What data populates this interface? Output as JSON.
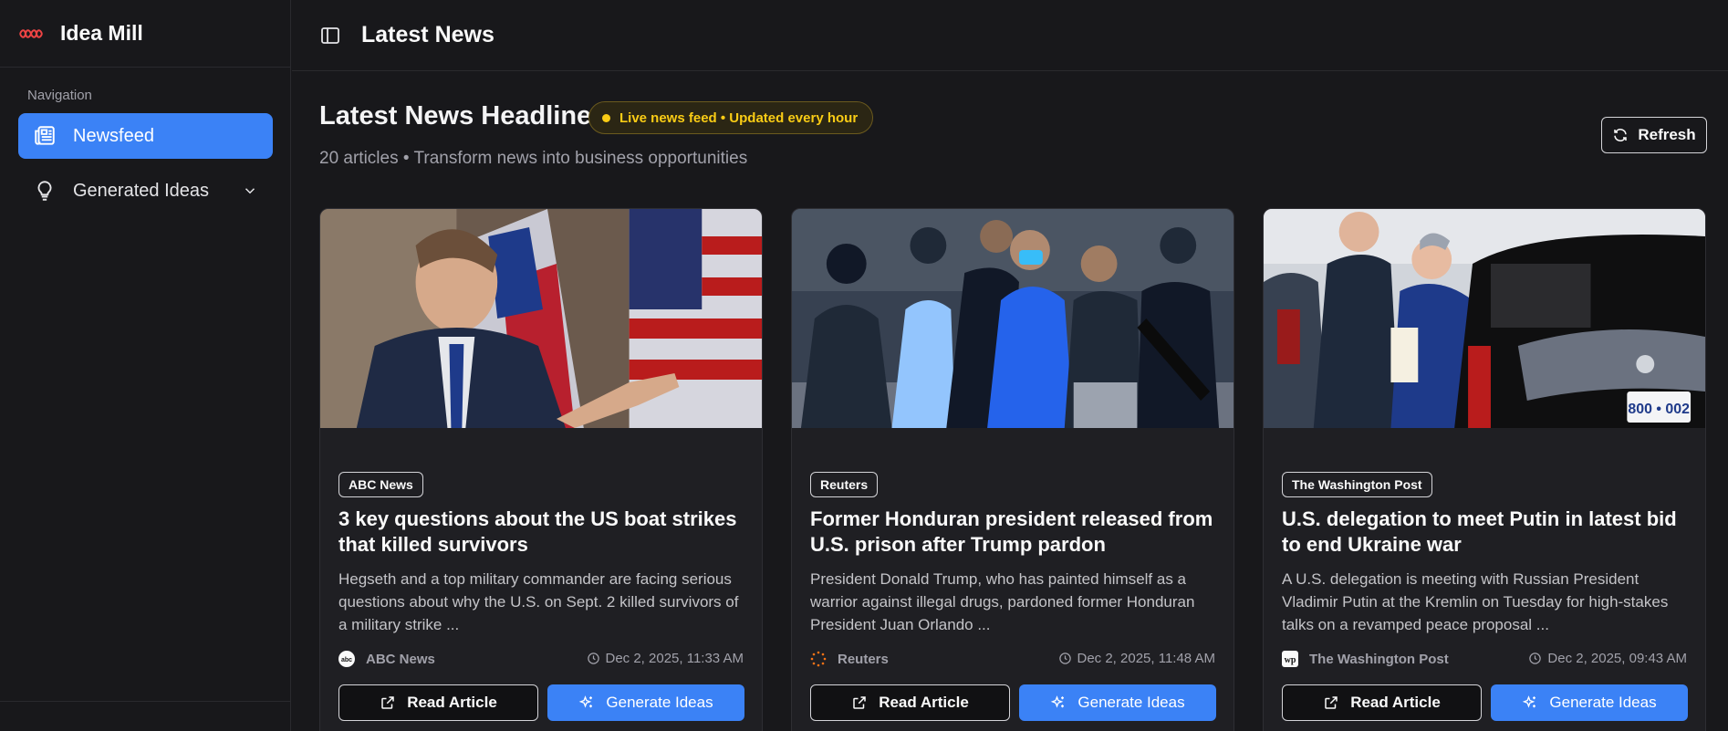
{
  "app": {
    "name": "Idea Mill"
  },
  "sidebar": {
    "heading": "Navigation",
    "items": [
      {
        "label": "Newsfeed",
        "icon": "newspaper-icon",
        "active": true
      },
      {
        "label": "Generated Ideas",
        "icon": "lightbulb-icon",
        "active": false
      }
    ]
  },
  "header": {
    "title": "Latest News"
  },
  "main": {
    "title": "Latest News Headlines",
    "badge": "Live news feed • Updated every hour",
    "subtitle": "20 articles • Transform news into business opportunities",
    "refresh_label": "Refresh"
  },
  "buttons": {
    "read": "Read Article",
    "generate": "Generate Ideas"
  },
  "articles": [
    {
      "source": "ABC News",
      "title": "3 key questions about the US boat strikes that killed survivors",
      "description": "Hegseth and a top military commander are facing serious questions about why the U.S. on Sept. 2 killed survivors of a military strike ...",
      "date": "Dec 2, 2025, 11:33 AM",
      "source_icon": "abc-logo-icon"
    },
    {
      "source": "Reuters",
      "title": "Former Honduran president released from U.S. prison after Trump pardon",
      "description": "President Donald Trump, who has painted himself as a warrior against illegal drugs, pardoned former Honduran President Juan Orlando ...",
      "date": "Dec 2, 2025, 11:48 AM",
      "source_icon": "reuters-logo-icon"
    },
    {
      "source": "The Washington Post",
      "title": "U.S. delegation to meet Putin in latest bid to end Ukraine war",
      "description": "A U.S. delegation is meeting with Russian President Vladimir Putin at the Kremlin on Tuesday for high-stakes talks on a revamped peace proposal ...",
      "date": "Dec 2, 2025, 09:43 AM",
      "source_icon": "wapo-logo-icon"
    }
  ],
  "colors": {
    "accent": "#3b82f6",
    "live": "#facc15",
    "background": "#18181b"
  }
}
